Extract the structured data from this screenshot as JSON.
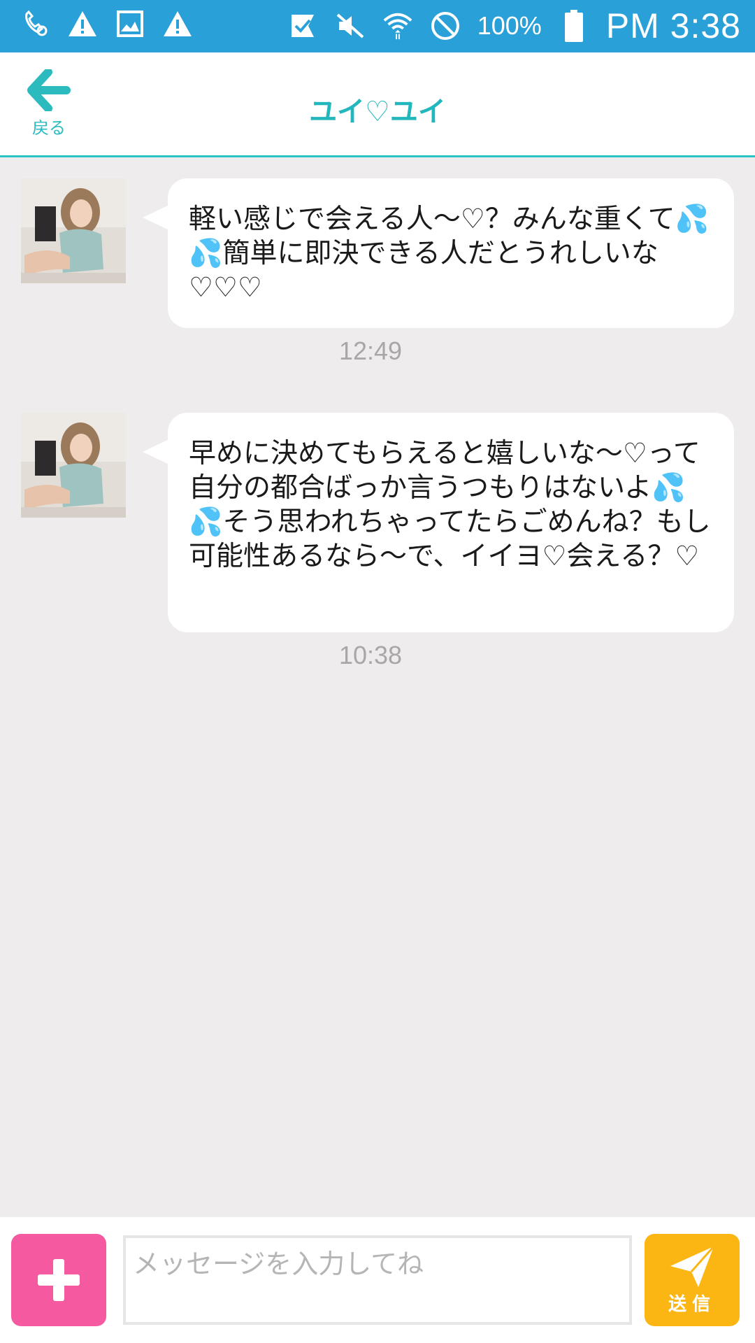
{
  "status_bar": {
    "left_icons": [
      "phone-settings-icon",
      "warning-icon",
      "image-icon",
      "warning-icon"
    ],
    "right_icons": [
      "checkmark-icon",
      "mute-icon",
      "wifi-icon",
      "block-icon"
    ],
    "battery_percent": "100%",
    "time": "PM 3:38",
    "background_color": "#2aa0d8"
  },
  "header": {
    "back_label": "戻る",
    "title": "ユイ♡ユイ",
    "accent_color": "#29c3c5"
  },
  "messages": [
    {
      "text": "軽い感じで会える人〜♡？みんな重くて💦💦簡単に即決できる人だとうれしいな♡♡♡",
      "time": "12:49"
    },
    {
      "text": "早めに決めてもらえると嬉しいな〜♡って自分の都合ばっか言うつもりはないよ💦💦そう思われちゃってたらごめんね？もし可能性あるなら〜で、イイヨ♡会える？♡",
      "time": "10:38"
    }
  ],
  "input_bar": {
    "plus_icon": "plus-icon",
    "placeholder": "メッセージを入力してね",
    "value": "",
    "send_label": "送信",
    "send_icon": "paper-plane-icon",
    "plus_color": "#f55aa0",
    "send_color": "#fcb614"
  }
}
